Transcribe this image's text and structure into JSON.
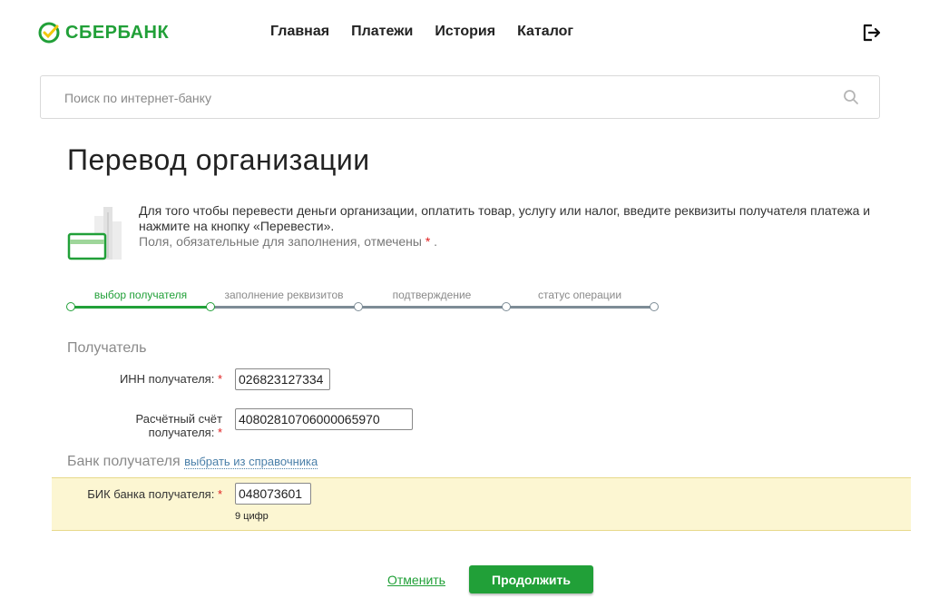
{
  "header": {
    "brand": "СБЕРБАНК",
    "nav": [
      "Главная",
      "Платежи",
      "История",
      "Каталог"
    ],
    "logout_icon": "logout-icon"
  },
  "search": {
    "placeholder": "Поиск по интернет-банку",
    "icon": "search-icon"
  },
  "page": {
    "title": "Перевод организации",
    "intro": "Для того чтобы перевести деньги организации, оплатить товар, услугу или налог, введите реквизиты получателя платежа и нажмите на кнопку «Перевести».",
    "required_note": "Поля, обязательные для заполнения, отмечены",
    "required_star": "*",
    "required_end": "."
  },
  "steps": [
    {
      "label": "выбор получателя",
      "active": true
    },
    {
      "label": "заполнение реквизитов",
      "active": false
    },
    {
      "label": "подтверждение",
      "active": false
    },
    {
      "label": "статус операции",
      "active": false
    }
  ],
  "recipient": {
    "section_title": "Получатель",
    "inn_label": "ИНН получателя:",
    "inn_value": "026823127334",
    "account_label_1": "Расчётный счёт",
    "account_label_2": "получателя:",
    "account_value": "40802810706000065970"
  },
  "bank": {
    "section_title": "Банк получателя",
    "directory_link": "выбрать из справочника",
    "bik_label": "БИК банка получателя:",
    "bik_value": "048073601",
    "bik_hint": "9 цифр"
  },
  "actions": {
    "cancel": "Отменить",
    "continue": "Продолжить"
  },
  "colors": {
    "brand_green": "#21a038",
    "highlight": "#fcf6d2",
    "required": "#e02020"
  }
}
